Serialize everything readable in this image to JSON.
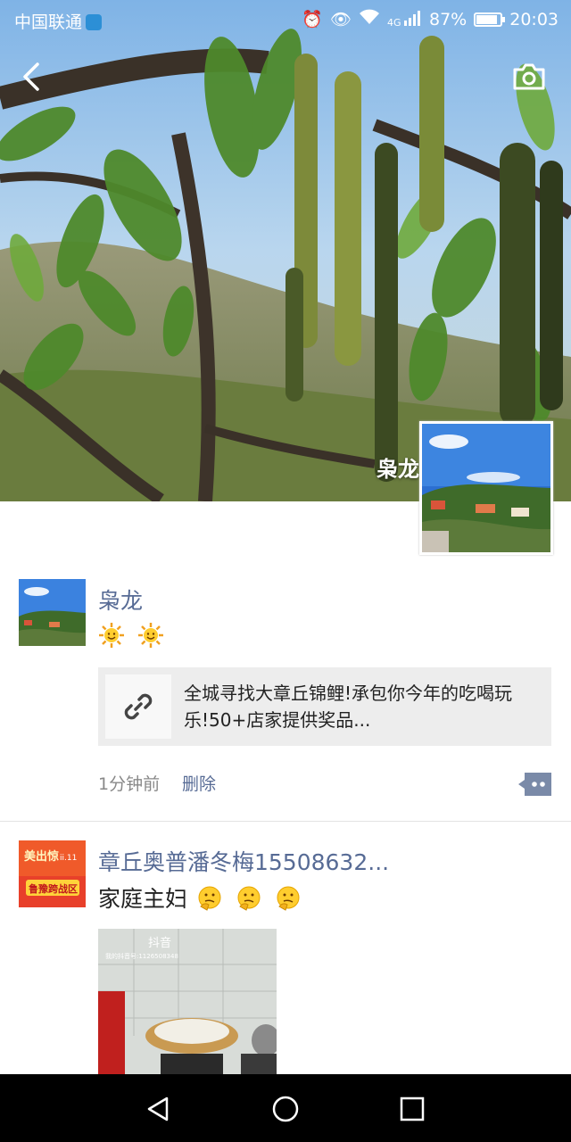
{
  "status_bar": {
    "carrier": "中国联通",
    "network": "4G",
    "battery": "87%",
    "time": "20:03"
  },
  "profile": {
    "name": "枭龙"
  },
  "icons": {
    "back": "back-arrow-icon",
    "camera": "camera-icon",
    "link": "link-icon",
    "comment": "comment-icon",
    "sun_emoji": "sun-emoji",
    "thinking_emoji": "thinking-face-emoji",
    "nav_back": "triangle-back-icon",
    "nav_home": "circle-home-icon",
    "nav_recent": "square-recents-icon"
  },
  "posts": [
    {
      "author": "枭龙",
      "link_title": "全城寻找大章丘锦鲤!承包你今年的吃喝玩乐!50+店家提供奖品...",
      "time": "1分钟前",
      "delete_label": "删除"
    },
    {
      "author": "章丘奥普潘冬梅15508632...",
      "text": "家庭主妇",
      "avatar_line1": "美出惊",
      "avatar_line2": "ii.11",
      "avatar_line3": "鲁豫跨战区",
      "image_watermark": "抖音",
      "image_id": "我的抖音号:1126508348"
    }
  ],
  "colors": {
    "name_link": "#576b95",
    "meta_gray": "#888888",
    "card_bg": "#ededed",
    "divider": "#e3e3e3"
  }
}
